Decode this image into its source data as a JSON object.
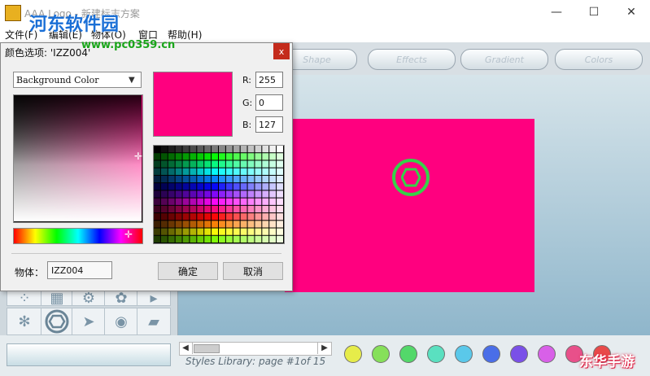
{
  "window": {
    "title": "AAA Logo - 新建标志方案",
    "minimize_glyph": "—",
    "maximize_glyph": "☐",
    "close_glyph": "✕",
    "icon": "app-logo-icon"
  },
  "menu": {
    "items": [
      "文件(F)",
      "编辑(E)",
      "物体(O)",
      "窗口",
      "帮助(H)"
    ]
  },
  "watermark": {
    "logo_text": "河东软件园",
    "url": "www.pc0359.cn",
    "bottom_right": "东华手游"
  },
  "toolbar": {
    "tabs": [
      "Shape",
      "Effects",
      "Gradient",
      "Colors"
    ]
  },
  "dialog": {
    "title": "颜色选项: 'IZZ004'",
    "close_glyph": "x",
    "color_target": "Background Color",
    "rgb": {
      "r_label": "R:",
      "r": "255",
      "g_label": "G:",
      "g": "0",
      "b_label": "B:",
      "b": "127"
    },
    "object_label": "物体：",
    "object_value": "IZZ004",
    "ok_label": "确定",
    "cancel_label": "取消",
    "selected_color": "#ff007f"
  },
  "canvas": {
    "background_color": "#ff007f",
    "accent_color": "#37d04a"
  },
  "styles_library": {
    "page_label": "Styles Library: page #1of 15",
    "scroll_left": "◀",
    "scroll_right": "▶"
  },
  "swatches": [
    "#e6ec4a",
    "#86e05a",
    "#53d86a",
    "#5ae0c0",
    "#5ac8ea",
    "#4a6ee8",
    "#7a50e8",
    "#d860e8",
    "#e8508a",
    "#e84a4a"
  ]
}
